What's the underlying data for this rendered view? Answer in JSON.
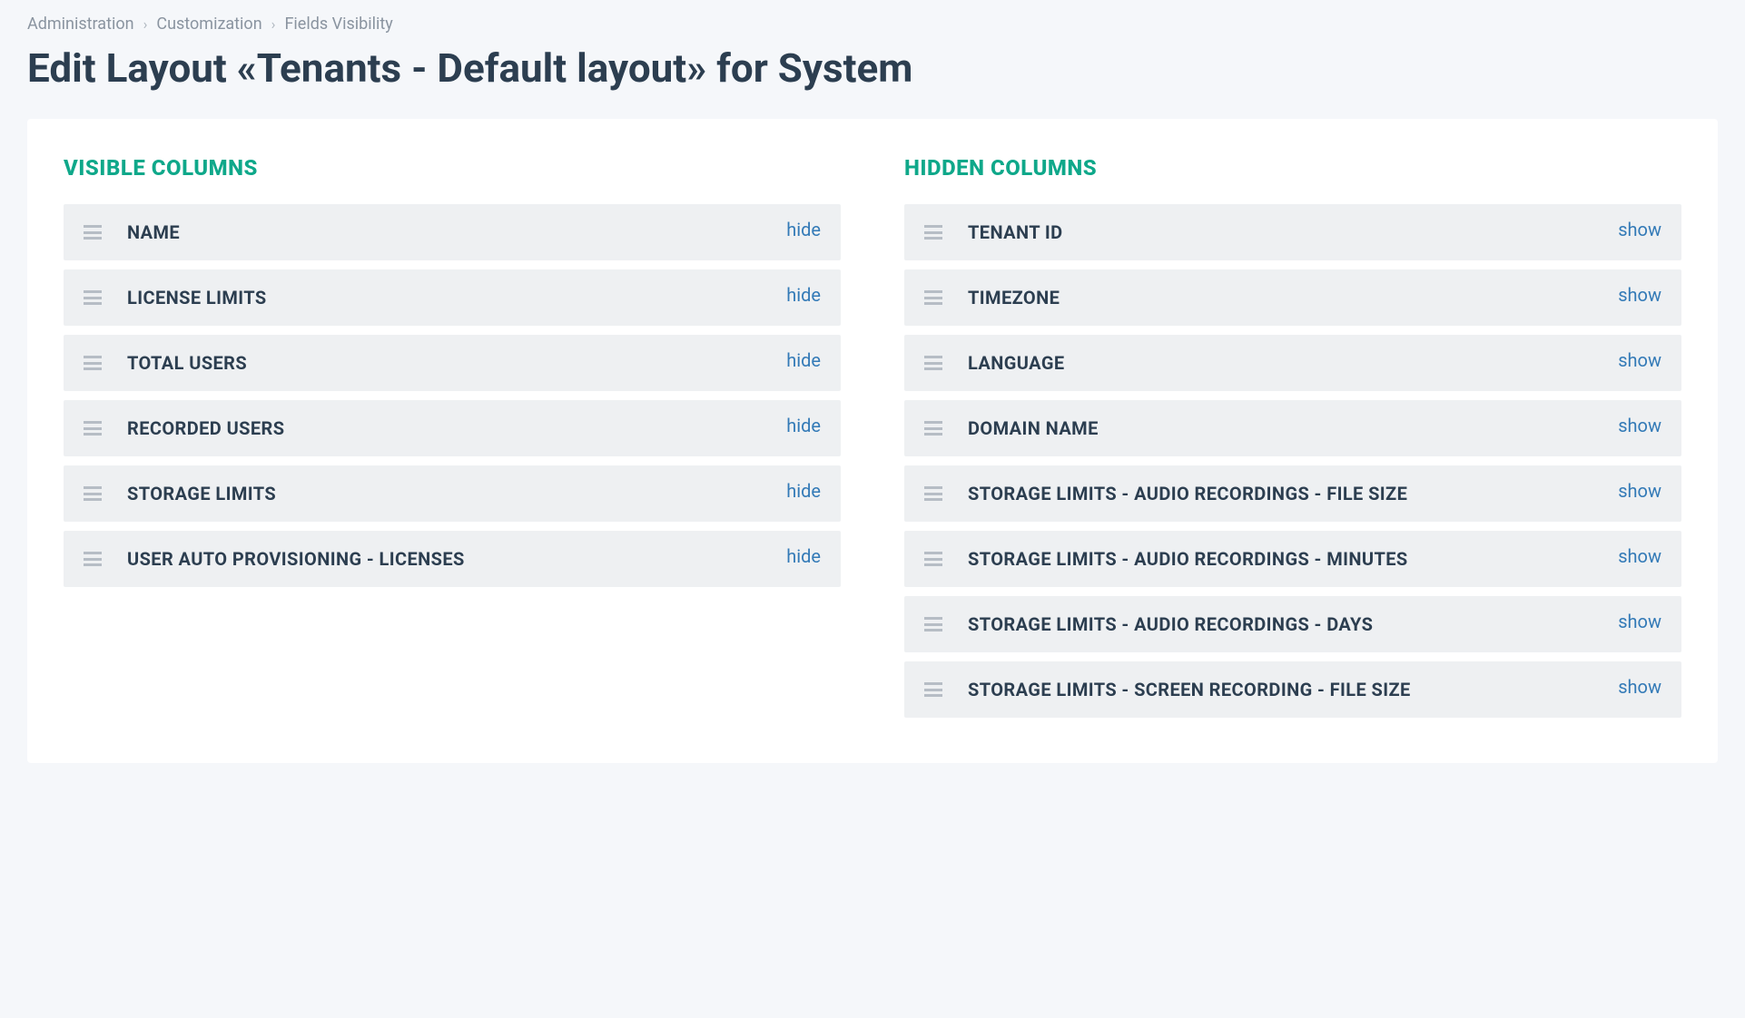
{
  "breadcrumbs": [
    {
      "label": "Administration"
    },
    {
      "label": "Customization"
    },
    {
      "label": "Fields Visibility"
    }
  ],
  "page_title": "Edit Layout «Tenants - Default layout» for System",
  "visible_section_title": "VISIBLE COLUMNS",
  "hidden_section_title": "HIDDEN COLUMNS",
  "hide_label": "hide",
  "show_label": "show",
  "visible_columns": [
    {
      "label": "NAME"
    },
    {
      "label": "LICENSE LIMITS"
    },
    {
      "label": "TOTAL USERS"
    },
    {
      "label": "RECORDED USERS"
    },
    {
      "label": "STORAGE LIMITS"
    },
    {
      "label": "USER AUTO PROVISIONING - LICENSES"
    }
  ],
  "hidden_columns": [
    {
      "label": "TENANT ID"
    },
    {
      "label": "TIMEZONE"
    },
    {
      "label": "LANGUAGE"
    },
    {
      "label": "DOMAIN NAME"
    },
    {
      "label": "STORAGE LIMITS - AUDIO RECORDINGS - FILE SIZE"
    },
    {
      "label": "STORAGE LIMITS - AUDIO RECORDINGS - MINUTES"
    },
    {
      "label": "STORAGE LIMITS - AUDIO RECORDINGS - DAYS"
    },
    {
      "label": "STORAGE LIMITS - SCREEN RECORDING - FILE SIZE"
    }
  ]
}
